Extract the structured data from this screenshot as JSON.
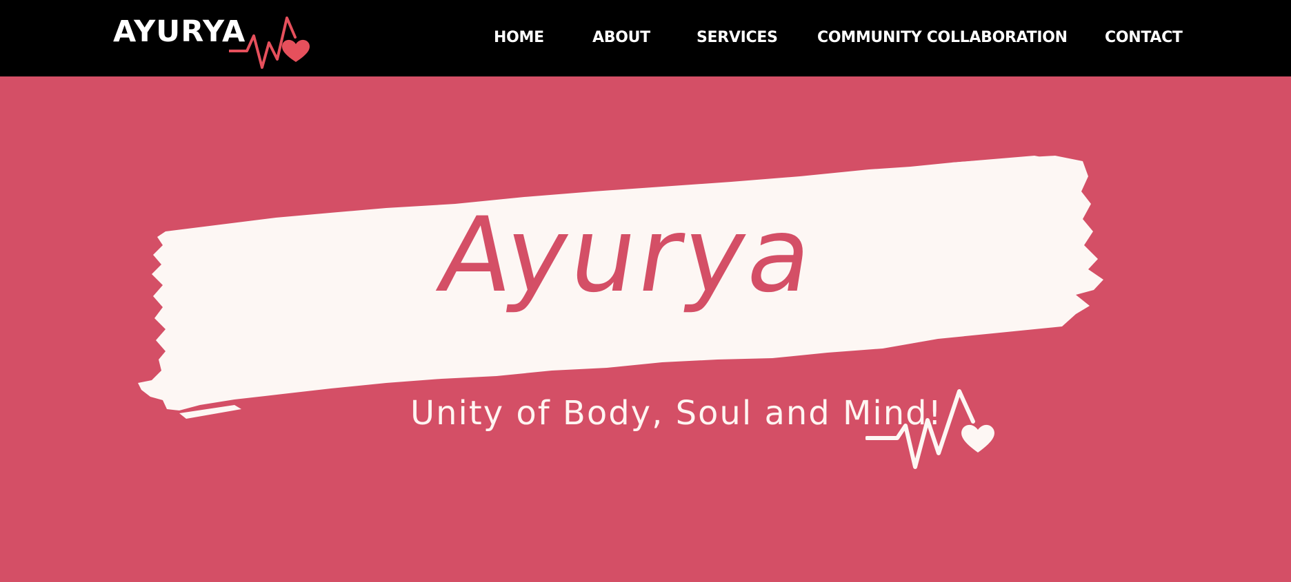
{
  "brand": {
    "logo_text": "AYURYA",
    "pulse_color": "#e6505c",
    "heart_icon": "heart-pulse-icon"
  },
  "nav": {
    "items": [
      {
        "label": "HOME"
      },
      {
        "label": "ABOUT"
      },
      {
        "label": "SERVICES"
      },
      {
        "label": "COMMUNITY COLLABORATION"
      },
      {
        "label": "CONTACT"
      }
    ]
  },
  "hero": {
    "title": "Ayurya",
    "tagline": "Unity of Body, Soul and Mind!",
    "background_color": "#d44f66",
    "brush_color": "#fdf7f4",
    "pulse_icon": "heart-pulse-icon"
  },
  "colors": {
    "topbar": "#000000",
    "text_light": "#ffffff",
    "accent": "#d44f66"
  }
}
